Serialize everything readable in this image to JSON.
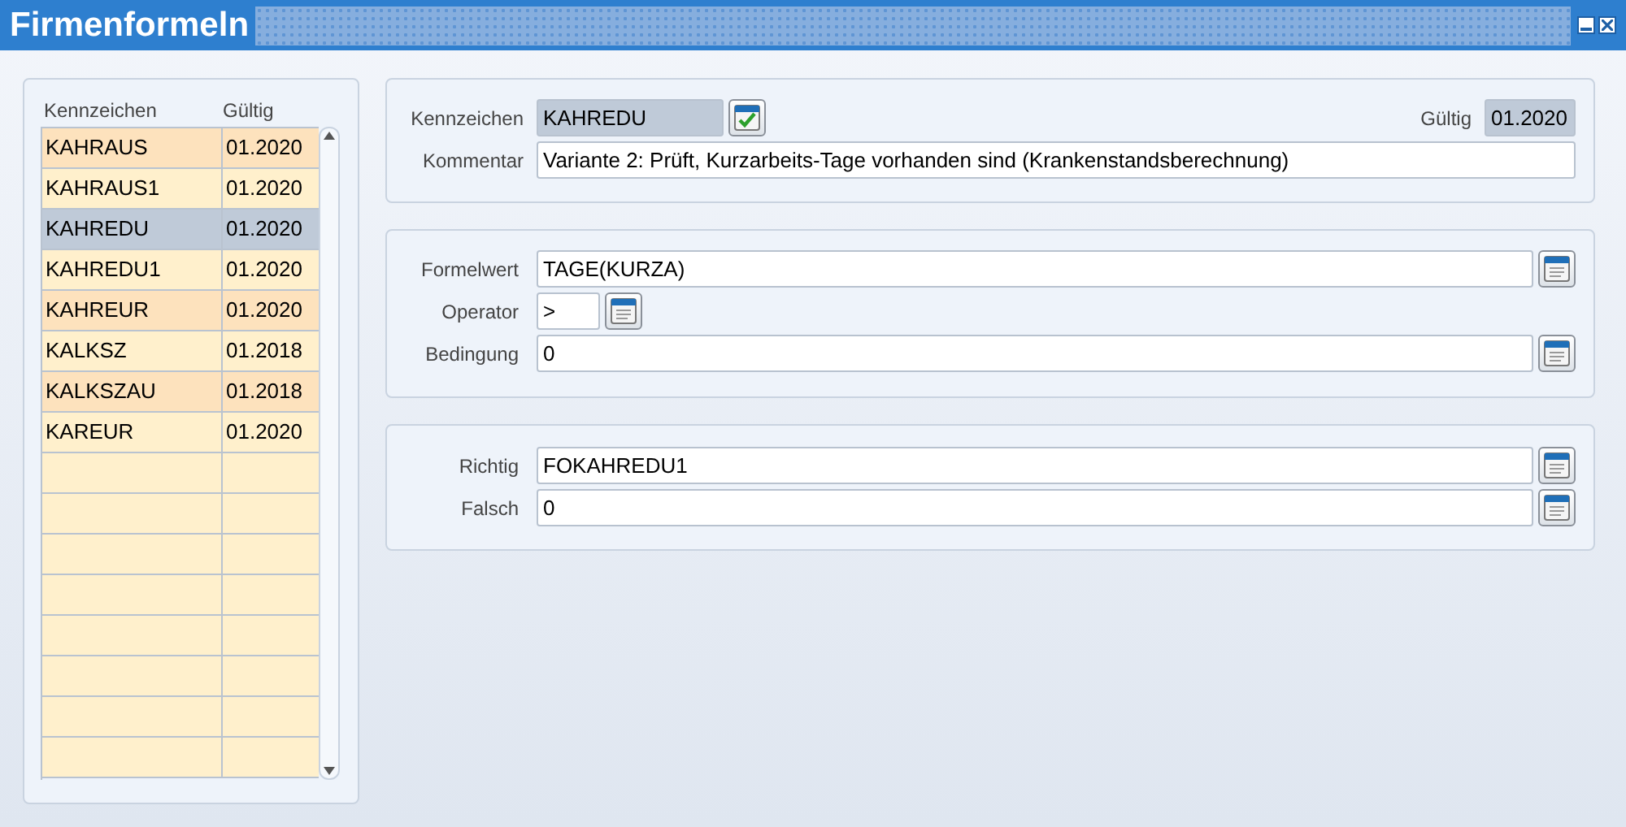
{
  "window": {
    "title": "Firmenformeln"
  },
  "list": {
    "columns": [
      "Kennzeichen",
      "Gültig"
    ],
    "rows": [
      {
        "kennzeichen": "KAHRAUS",
        "gueltig": "01.2020",
        "selected": false,
        "shaded": true
      },
      {
        "kennzeichen": "KAHRAUS1",
        "gueltig": "01.2020",
        "selected": false,
        "shaded": false
      },
      {
        "kennzeichen": "KAHREDU",
        "gueltig": "01.2020",
        "selected": true,
        "shaded": false
      },
      {
        "kennzeichen": "KAHREDU1",
        "gueltig": "01.2020",
        "selected": false,
        "shaded": false
      },
      {
        "kennzeichen": "KAHREUR",
        "gueltig": "01.2020",
        "selected": false,
        "shaded": true
      },
      {
        "kennzeichen": "KALKSZ",
        "gueltig": "01.2018",
        "selected": false,
        "shaded": false
      },
      {
        "kennzeichen": "KALKSZAU",
        "gueltig": "01.2018",
        "selected": false,
        "shaded": true
      },
      {
        "kennzeichen": "KAREUR",
        "gueltig": "01.2020",
        "selected": false,
        "shaded": false
      }
    ]
  },
  "header": {
    "kennzeichen_label": "Kennzeichen",
    "kennzeichen": "KAHREDU",
    "gueltig_label": "Gültig",
    "gueltig": "01.2020",
    "kommentar_label": "Kommentar",
    "kommentar": "Variante 2: Prüft, Kurzarbeits-Tage vorhanden sind (Krankenstandsberechnung)"
  },
  "condition": {
    "formelwert_label": "Formelwert",
    "formelwert": "TAGE(KURZA)",
    "operator_label": "Operator",
    "operator": ">",
    "bedingung_label": "Bedingung",
    "bedingung": "0"
  },
  "result": {
    "richtig_label": "Richtig",
    "richtig": "FOKAHREDU1",
    "falsch_label": "Falsch",
    "falsch": "0"
  }
}
